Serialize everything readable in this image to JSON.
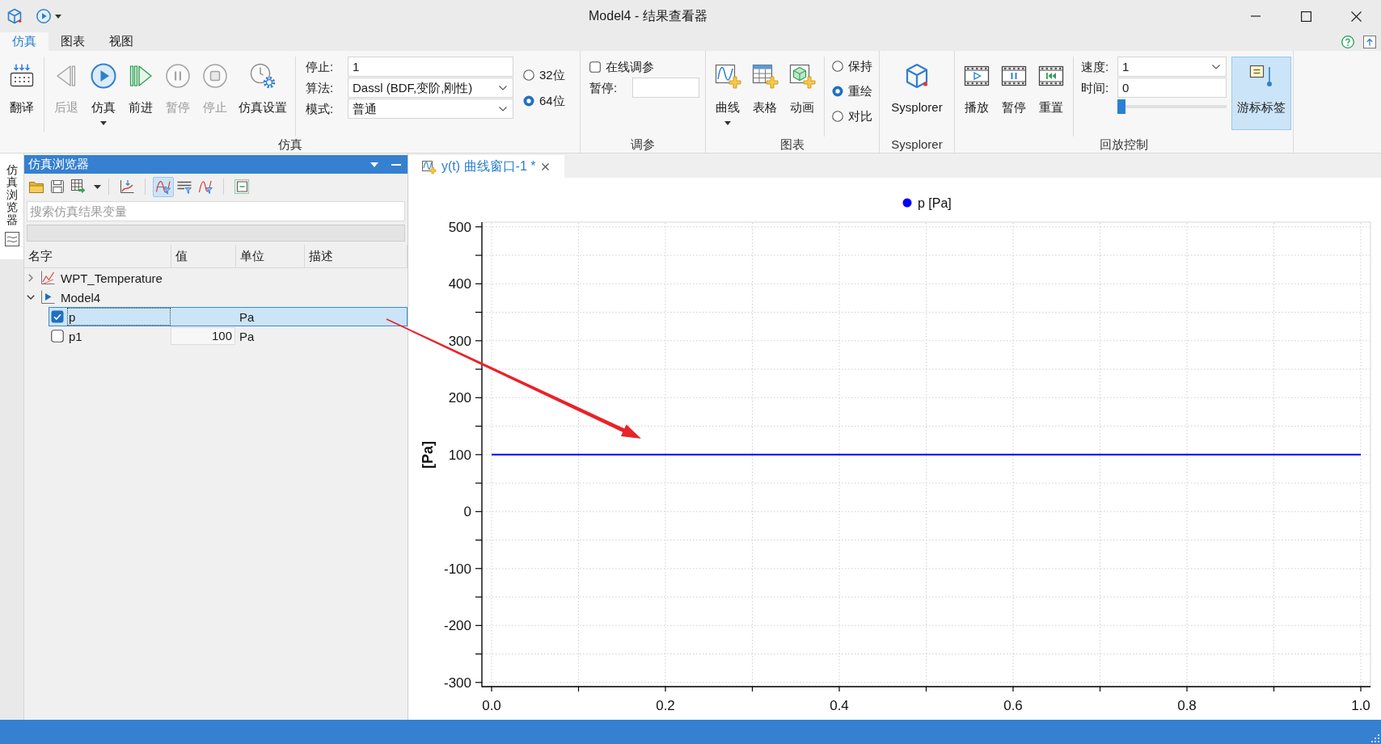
{
  "window": {
    "title": "Model4 - 结果查看器"
  },
  "ribbon_tabs": [
    {
      "label": "仿真",
      "selected": true
    },
    {
      "label": "图表",
      "selected": false
    },
    {
      "label": "视图",
      "selected": false
    }
  ],
  "ribbon": {
    "groups": [
      {
        "title": "仿真",
        "sections": [
          {
            "kind": "buttons",
            "buttons": [
              {
                "kind": "translate",
                "label": "翻译",
                "disabled": false,
                "dropdown": false
              }
            ]
          },
          {
            "kind": "buttons",
            "buttons": [
              {
                "kind": "back",
                "label": "后退",
                "disabled": true,
                "dropdown": false
              },
              {
                "kind": "simulate",
                "label": "仿真",
                "disabled": false,
                "dropdown": true
              },
              {
                "kind": "forward",
                "label": "前进",
                "disabled": false,
                "dropdown": false
              },
              {
                "kind": "pause",
                "label": "暂停",
                "disabled": true,
                "dropdown": false
              },
              {
                "kind": "stop",
                "label": "停止",
                "disabled": true,
                "dropdown": false
              },
              {
                "kind": "settings",
                "label": "仿真设置",
                "disabled": false,
                "dropdown": false
              }
            ]
          },
          {
            "kind": "form",
            "fields": [
              {
                "kind": "text",
                "label": "停止:",
                "value": "1"
              },
              {
                "kind": "select",
                "label": "算法:",
                "value": "Dassl (BDF,变阶,刚性)"
              },
              {
                "kind": "select",
                "label": "模式:",
                "value": "普通"
              }
            ],
            "radios": [
              {
                "label": "32位",
                "selected": false
              },
              {
                "label": "64位",
                "selected": true
              }
            ]
          }
        ]
      },
      {
        "title": "调参",
        "sections": [
          {
            "kind": "form",
            "fields": [
              {
                "kind": "check",
                "label": "在线调参",
                "checked": false
              },
              {
                "kind": "text",
                "label": "暂停:"
              }
            ]
          }
        ]
      },
      {
        "title": "图表",
        "sections": [
          {
            "kind": "buttons",
            "buttons": [
              {
                "kind": "curve",
                "label": "曲线",
                "dropdown": true
              },
              {
                "kind": "table",
                "label": "表格",
                "dropdown": false
              },
              {
                "kind": "animation",
                "label": "动画",
                "dropdown": false
              }
            ]
          },
          {
            "kind": "form",
            "radios": [
              {
                "label": "保持",
                "selected": false
              },
              {
                "label": "重绘",
                "selected": true
              },
              {
                "label": "对比",
                "selected": false
              }
            ]
          }
        ]
      },
      {
        "title": "Sysplorer",
        "sections": [
          {
            "kind": "buttons",
            "buttons": [
              {
                "kind": "sysplorer",
                "label": "Sysplorer"
              }
            ]
          }
        ]
      },
      {
        "title": "回放控制",
        "sections": [
          {
            "kind": "buttons",
            "buttons": [
              {
                "kind": "play",
                "label": "播放"
              },
              {
                "kind": "suspend",
                "label": "暂停"
              },
              {
                "kind": "reset",
                "label": "重置"
              }
            ]
          },
          {
            "kind": "form",
            "fields": [
              {
                "kind": "select",
                "label": "速度:",
                "value": "1"
              },
              {
                "kind": "text",
                "label": "时间:",
                "value": "0"
              },
              {
                "kind": "slider",
                "level": 0
              }
            ]
          },
          {
            "kind": "toggle",
            "buttons": [
              {
                "kind": "cursor",
                "label": "游标标签",
                "on": true
              }
            ]
          }
        ]
      }
    ]
  },
  "side_tabs": [
    {
      "label": "仿真浏览器",
      "selected": true
    }
  ],
  "browser": {
    "title": "仿真浏览器",
    "toolbar": [
      [
        {
          "kind": "open",
          "on": false
        },
        {
          "kind": "save",
          "on": false
        },
        {
          "kind": "export",
          "on": false
        }
      ],
      [
        {
          "kind": "import",
          "on": false
        }
      ],
      [
        {
          "kind": "curves",
          "on": true
        },
        {
          "kind": "lines",
          "on": false
        },
        {
          "kind": "waves",
          "on": false
        }
      ],
      [
        {
          "kind": "collapse",
          "on": false
        }
      ]
    ],
    "search": {
      "placeholder": "搜索仿真结果变量"
    },
    "columns": [
      "名字",
      "值",
      "单位",
      "描述"
    ],
    "tree": [
      {
        "kind": "dataset",
        "name": "WPT_Temperature",
        "expanded": false,
        "selected": false
      },
      {
        "kind": "model",
        "name": "Model4",
        "expanded": true,
        "selected": false,
        "children": [
          {
            "kind": "variable",
            "name": "p",
            "unit": "Pa",
            "checked": true,
            "selected": true
          },
          {
            "kind": "variable",
            "name": "p1",
            "value": "100",
            "unit": "Pa",
            "checked": false,
            "selected": false
          }
        ]
      }
    ]
  },
  "plot_window": {
    "tabs": [
      {
        "label": "y(t) 曲线窗口-1 *",
        "selected": true
      }
    ],
    "chart_data": {
      "type": "line",
      "ylabel": "[Pa]",
      "x": [
        0,
        1
      ],
      "series": [
        {
          "name": "p [Pa]",
          "color": "#0000ff",
          "values": [
            100,
            100
          ]
        }
      ],
      "xlim": [
        0,
        1
      ],
      "ylim": [
        -300,
        500
      ],
      "xticks": [
        {
          "value": 0,
          "label": "0.0"
        },
        {
          "value": 0.2,
          "label": "0.2"
        },
        {
          "value": 0.4,
          "label": "0.4"
        },
        {
          "value": 0.6,
          "label": "0.6"
        },
        {
          "value": 0.8,
          "label": "0.8"
        },
        {
          "value": 1,
          "label": "1.0"
        }
      ],
      "yticks": [
        -300,
        -200,
        -100,
        0,
        100,
        200,
        300,
        400,
        500
      ],
      "grid": true
    }
  }
}
